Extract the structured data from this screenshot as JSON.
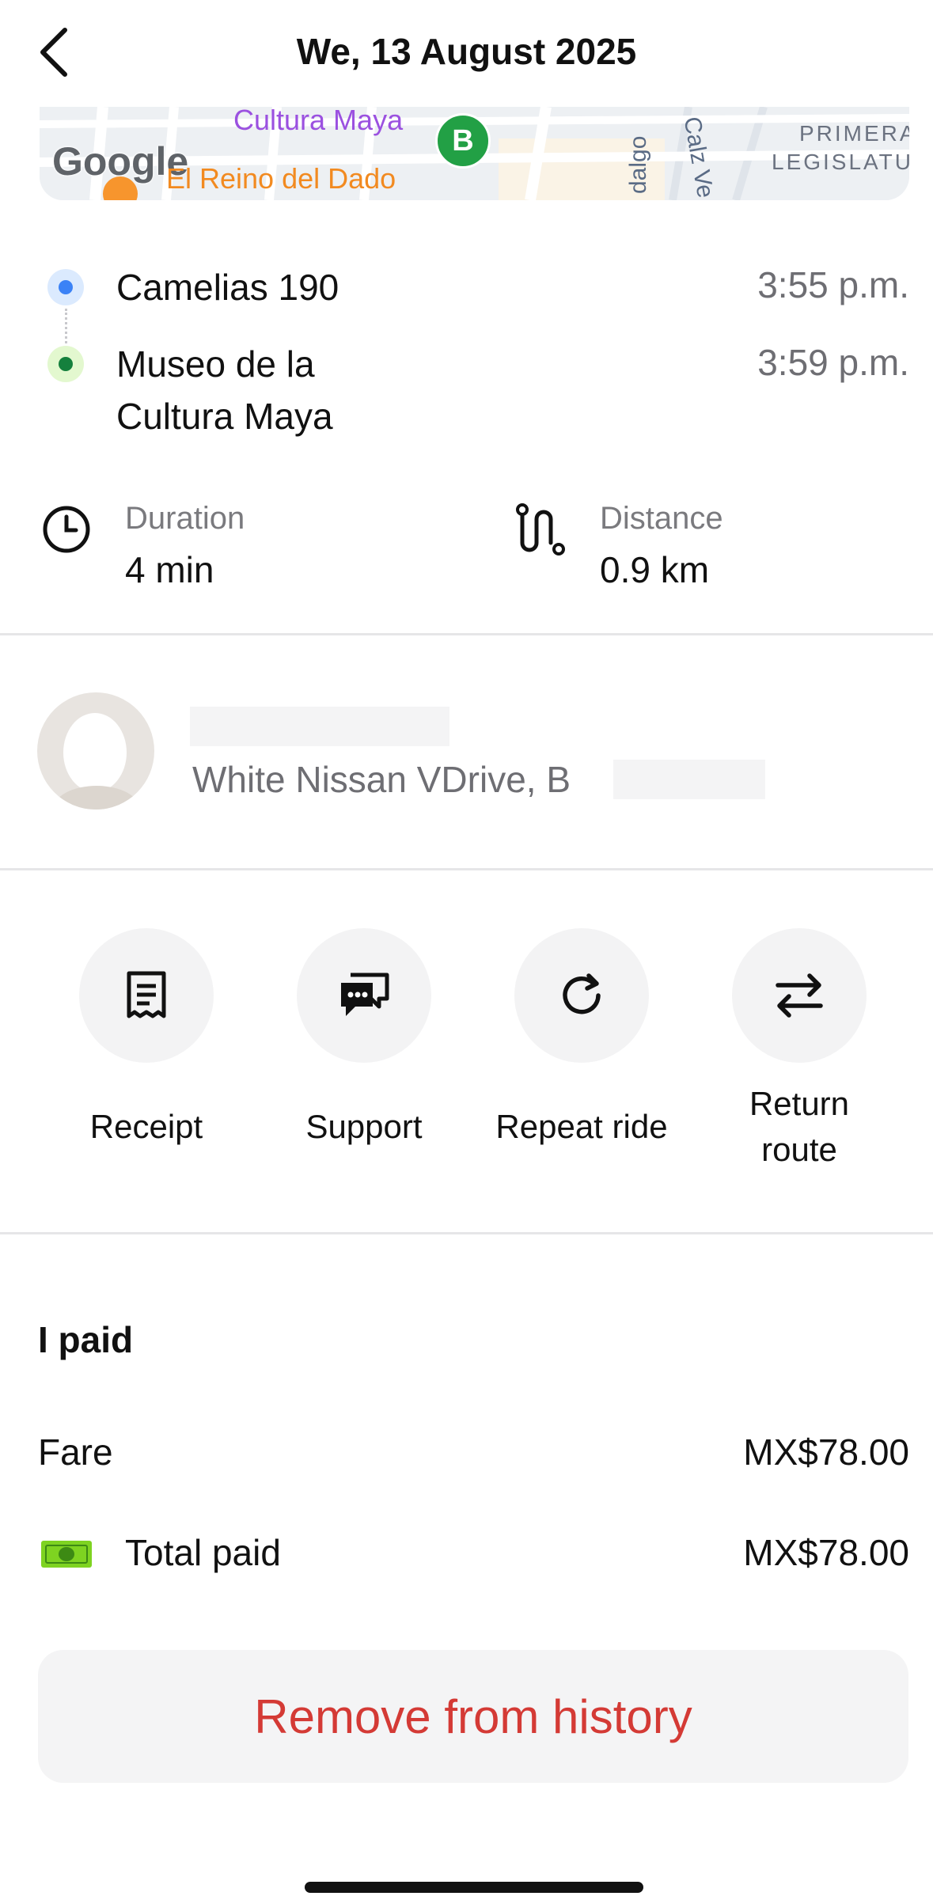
{
  "header": {
    "title": "We, 13 August 2025",
    "back_icon": "chevron-left-icon"
  },
  "map": {
    "poi_cultura": "Cultura Maya",
    "marker_b": "B",
    "google_logo": "Google",
    "poi_reino": "El Reino del Dado",
    "street_hidalgo": "dalgo",
    "street_calz": "Calz Ve",
    "area_line1": "PRIMERA",
    "area_line2": "LEGISLATU"
  },
  "route": {
    "pickup": {
      "label": "Camelias 190",
      "time": "3:55 p.m."
    },
    "dropoff": {
      "label_line1": "Museo de la",
      "label_line2": "Cultura Maya",
      "time": "3:59 p.m."
    }
  },
  "stats": {
    "duration_caption": "Duration",
    "duration_value": "4 min",
    "distance_caption": "Distance",
    "distance_value": "0.9 km"
  },
  "driver": {
    "vehicle": "White Nissan VDrive, B"
  },
  "actions": [
    {
      "label": "Receipt",
      "icon": "receipt-icon"
    },
    {
      "label": "Support",
      "icon": "chat-support-icon"
    },
    {
      "label": "Repeat ride",
      "icon": "refresh-icon"
    },
    {
      "label_line1": "Return",
      "label_line2": "route",
      "icon": "swap-arrows-icon"
    }
  ],
  "payment": {
    "title": "I paid",
    "fare_label": "Fare",
    "fare_value": "MX$78.00",
    "total_label": "Total paid",
    "total_value": "MX$78.00",
    "method_icon": "cash-icon"
  },
  "remove_button": "Remove from history",
  "colors": {
    "pickup_dot": "#3b82f6",
    "dropoff_dot": "#16a34a",
    "danger": "#d43a35",
    "cash": "#7ed321",
    "marker": "#22a045"
  }
}
